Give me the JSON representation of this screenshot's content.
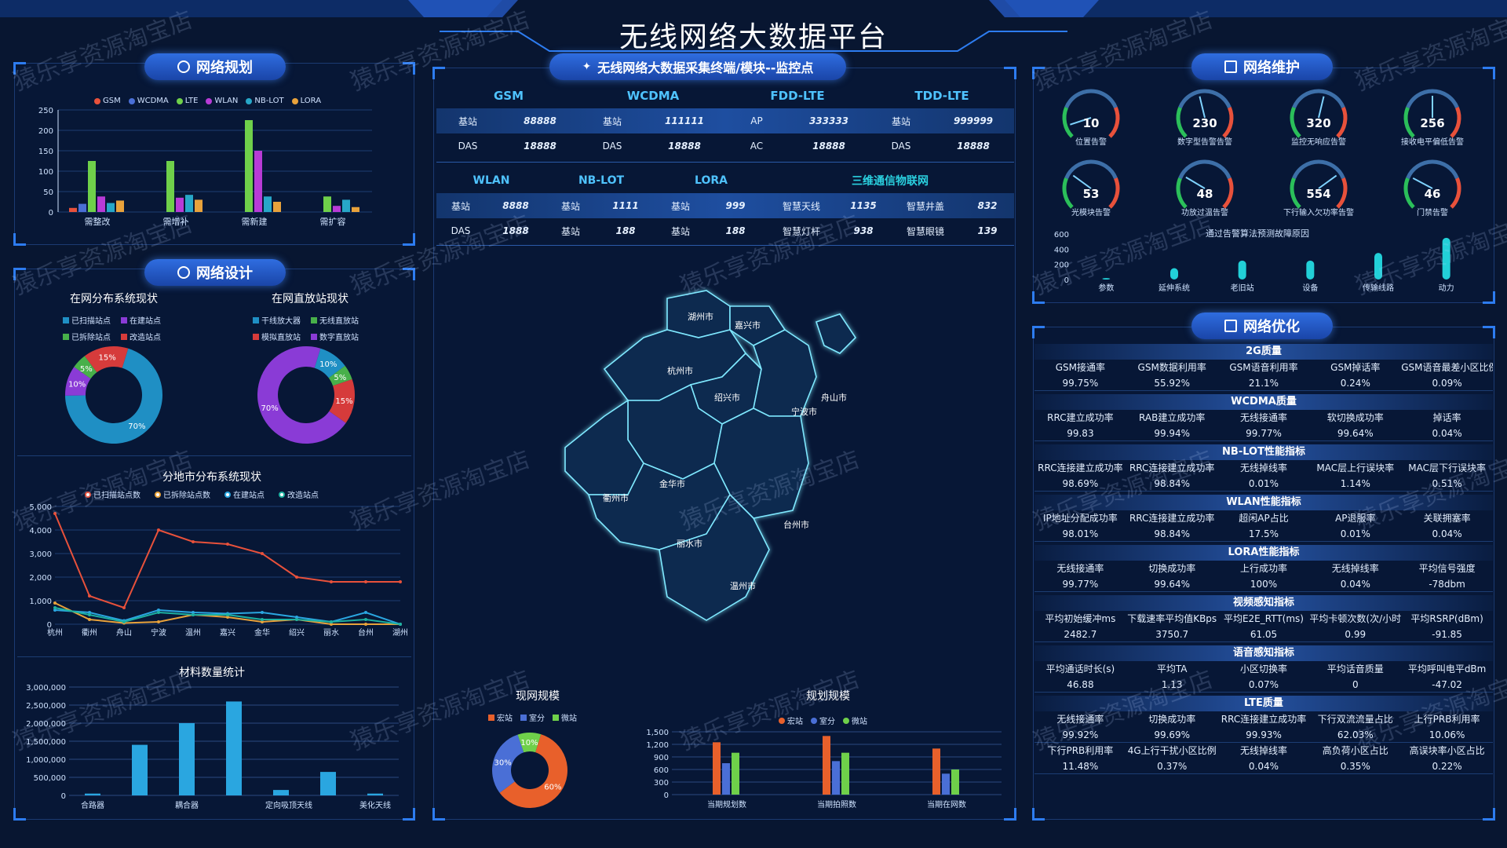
{
  "title": "无线网络大数据平台",
  "watermark": "猿乐享资源淘宝店",
  "colors": {
    "gsm": "#e8513b",
    "wcdma": "#4a6fd6",
    "lte": "#6fd04a",
    "wlan": "#b83bd6",
    "nblot": "#27a7c8",
    "lora": "#e8a23b"
  },
  "left": {
    "planning": {
      "title": "网络规划",
      "legend": [
        "GSM",
        "WCDMA",
        "LTE",
        "WLAN",
        "NB-LOT",
        "LORA"
      ],
      "yticks": [
        "250",
        "200",
        "150",
        "100",
        "50",
        "0"
      ],
      "chart_data": {
        "type": "bar",
        "categories": [
          "需整改",
          "需增补",
          "需新建",
          "需扩容"
        ],
        "ylim": [
          0,
          250
        ],
        "series": [
          {
            "name": "GSM",
            "values": [
              10,
              0,
              0,
              0
            ]
          },
          {
            "name": "WCDMA",
            "values": [
              20,
              0,
              0,
              0
            ]
          },
          {
            "name": "LTE",
            "values": [
              125,
              125,
              225,
              38
            ]
          },
          {
            "name": "WLAN",
            "values": [
              38,
              35,
              150,
              15
            ]
          },
          {
            "name": "NB-LOT",
            "values": [
              22,
              42,
              38,
              30
            ]
          },
          {
            "name": "LORA",
            "values": [
              28,
              30,
              25,
              12
            ]
          }
        ]
      }
    },
    "design": {
      "title": "网络设计",
      "donut1": {
        "title": "在网分布系统现状",
        "legend": [
          "已扫描站点",
          "在建站点",
          "已拆除站点",
          "改造站点"
        ],
        "chart_data": {
          "type": "pie",
          "labels": [
            "已扫描站点",
            "在建站点",
            "已拆除站点",
            "改造站点"
          ],
          "values": [
            70,
            10,
            5,
            15
          ],
          "colors": [
            "#1f8fc4",
            "#8a3bd6",
            "#48b04a",
            "#d63b3b"
          ]
        },
        "pct": [
          "70%",
          "10%",
          "5%",
          "15%"
        ]
      },
      "donut2": {
        "title": "在网直放站现状",
        "legend": [
          "干线放大器",
          "无线直放站",
          "模拟直放站",
          "数字直放站"
        ],
        "chart_data": {
          "type": "pie",
          "labels": [
            "干线放大器",
            "无线直放站",
            "模拟直放站",
            "数字直放站"
          ],
          "values": [
            10,
            5,
            15,
            70
          ],
          "colors": [
            "#1f8fc4",
            "#48b04a",
            "#d63b3b",
            "#8a3bd6"
          ]
        },
        "pct": [
          "10%",
          "5%",
          "15%",
          "70%"
        ]
      },
      "line": {
        "title": "分地市分布系统现状",
        "legend": [
          "已扫描站点数",
          "已拆除站点数",
          "在建站点",
          "改造站点"
        ],
        "yticks": [
          "5,000",
          "4,000",
          "3,000",
          "2,000",
          "1,000",
          "0"
        ],
        "chart_data": {
          "type": "line",
          "categories": [
            "杭州",
            "衢州",
            "舟山",
            "宁波",
            "温州",
            "嘉兴",
            "金华",
            "绍兴",
            "丽水",
            "台州",
            "湖州"
          ],
          "ylim": [
            0,
            5000
          ],
          "series": [
            {
              "name": "已扫描站点数",
              "values": [
                4700,
                1200,
                700,
                4000,
                3500,
                3400,
                3000,
                2000,
                1800,
                1800,
                1800
              ],
              "color": "#e8513b"
            },
            {
              "name": "已拆除站点数",
              "values": [
                900,
                200,
                50,
                100,
                400,
                300,
                100,
                200,
                0,
                0,
                0
              ],
              "color": "#e8a23b"
            },
            {
              "name": "在建站点",
              "values": [
                600,
                500,
                150,
                600,
                500,
                450,
                500,
                300,
                100,
                500,
                0
              ],
              "color": "#2aa6e0"
            },
            {
              "name": "改造站点",
              "values": [
                700,
                400,
                100,
                500,
                400,
                400,
                200,
                200,
                100,
                200,
                0
              ],
              "color": "#1db0a0"
            }
          ]
        }
      }
    },
    "material": {
      "title": "材料数量统计",
      "yticks": [
        "3,000,000",
        "2,500,000",
        "2,000,000",
        "1,500,000",
        "1,000,000",
        "500,000",
        "0"
      ],
      "xlabels": [
        "合路器",
        "耦合器",
        "定向吸顶天线",
        "美化天线"
      ],
      "chart_data": {
        "type": "bar",
        "categories": [
          "合路器",
          "",
          "耦合器",
          "",
          "定向吸顶天线",
          "",
          "美化天线"
        ],
        "values": [
          50000,
          1400000,
          2000000,
          2600000,
          150000,
          650000,
          50000
        ],
        "ylim": [
          0,
          3000000
        ]
      }
    }
  },
  "center": {
    "pill": "无线网络大数据采集终端/模块--监控点",
    "t1_headers": [
      "GSM",
      "WCDMA",
      "FDD-LTE",
      "TDD-LTE"
    ],
    "t1_rows": [
      [
        "基站",
        "88888",
        "基站",
        "111111",
        "AP",
        "333333",
        "基站",
        "999999"
      ],
      [
        "DAS",
        "18888",
        "DAS",
        "18888",
        "AC",
        "18888",
        "DAS",
        "18888"
      ]
    ],
    "t2_headers": [
      "WLAN",
      "NB-LOT",
      "LORA",
      "三维通信物联网"
    ],
    "t2_rows": [
      [
        "基站",
        "8888",
        "基站",
        "1111",
        "基站",
        "999",
        "智慧天线",
        "1135",
        "智慧井盖",
        "832"
      ],
      [
        "DAS",
        "1888",
        "基站",
        "188",
        "基站",
        "188",
        "智慧灯杆",
        "938",
        "智慧眼镜",
        "139"
      ]
    ],
    "map_cities": [
      "湖州市",
      "嘉兴市",
      "杭州市",
      "绍兴市",
      "舟山市",
      "宁波市",
      "金华市",
      "衢州市",
      "台州市",
      "丽水市",
      "温州市"
    ],
    "scale": {
      "title": "现网规模",
      "legend": [
        "宏站",
        "室分",
        "微站"
      ],
      "chart_data": {
        "type": "pie",
        "labels": [
          "宏站",
          "室分",
          "微站"
        ],
        "values": [
          60,
          30,
          10
        ],
        "colors": [
          "#e8602b",
          "#4a6fd6",
          "#6fd04a"
        ]
      },
      "pct": [
        "60%",
        "30%",
        "10%"
      ]
    },
    "plan": {
      "title": "规划规模",
      "legend": [
        "宏站",
        "室分",
        "微站"
      ],
      "yticks": [
        "1,500",
        "1,200",
        "900",
        "600",
        "300",
        "0"
      ],
      "chart_data": {
        "type": "bar",
        "categories": [
          "当期规划数",
          "当期拍照数",
          "当期在网数"
        ],
        "ylim": [
          0,
          1500
        ],
        "series": [
          {
            "name": "宏站",
            "values": [
              1250,
              1400,
              1100
            ]
          },
          {
            "name": "室分",
            "values": [
              750,
              800,
              500
            ]
          },
          {
            "name": "微站",
            "values": [
              1000,
              1000,
              600
            ]
          }
        ]
      }
    }
  },
  "right": {
    "maint": {
      "title": "网络维护",
      "gauges": [
        {
          "value": "10",
          "label": "位置告警",
          "ratio": 0.1
        },
        {
          "value": "230",
          "label": "数字型告警告警",
          "ratio": 0.45
        },
        {
          "value": "320",
          "label": "监控无响应告警",
          "ratio": 0.55
        },
        {
          "value": "256",
          "label": "接收电平偏低告警",
          "ratio": 0.5
        },
        {
          "value": "53",
          "label": "光模块告警",
          "ratio": 0.3
        },
        {
          "value": "48",
          "label": "功放过温告警",
          "ratio": 0.28
        },
        {
          "value": "554",
          "label": "下行输入欠功率告警",
          "ratio": 0.7
        },
        {
          "value": "46",
          "label": "门禁告警",
          "ratio": 0.27
        }
      ],
      "bar_title": "通过告警算法预测故障原因",
      "yticks": [
        "600",
        "400",
        "200",
        "0"
      ],
      "chart_data": {
        "type": "bar",
        "categories": [
          "参数",
          "延伸系统",
          "老旧站",
          "设备",
          "传输线路",
          "动力"
        ],
        "values": [
          20,
          150,
          250,
          250,
          350,
          550
        ],
        "ylim": [
          0,
          600
        ]
      }
    },
    "opt": {
      "title": "网络优化",
      "sections": [
        {
          "name": "2G质量",
          "heads": [
            "GSM接通率",
            "GSM数据利用率",
            "GSM语音利用率",
            "GSM掉话率",
            "GSM语音最差小区比例"
          ],
          "vals": [
            "99.75%",
            "55.92%",
            "21.1%",
            "0.24%",
            "0.09%"
          ]
        },
        {
          "name": "WCDMA质量",
          "heads": [
            "RRC建立成功率",
            "RAB建立成功率",
            "无线接通率",
            "软切换成功率",
            "掉话率"
          ],
          "vals": [
            "99.83",
            "99.94%",
            "99.77%",
            "99.64%",
            "0.04%"
          ]
        },
        {
          "name": "NB-LOT性能指标",
          "heads": [
            "RRC连接建立成功率",
            "RRC连接建立成功率",
            "无线掉线率",
            "MAC层上行误块率",
            "MAC层下行误块率"
          ],
          "vals": [
            "98.69%",
            "98.84%",
            "0.01%",
            "1.14%",
            "0.51%"
          ]
        },
        {
          "name": "WLAN性能指标",
          "heads": [
            "IP地址分配成功率",
            "RRC连接建立成功率",
            "超闲AP占比",
            "AP退服率",
            "关联拥塞率"
          ],
          "vals": [
            "98.01%",
            "98.84%",
            "17.5%",
            "0.01%",
            "0.04%"
          ]
        },
        {
          "name": "LORA性能指标",
          "heads": [
            "无线接通率",
            "切换成功率",
            "上行成功率",
            "无线掉线率",
            "平均信号强度"
          ],
          "vals": [
            "99.77%",
            "99.64%",
            "100%",
            "0.04%",
            "-78dbm"
          ]
        },
        {
          "name": "视频感知指标",
          "heads": [
            "平均初始缓冲ms",
            "下载速率平均值KBps",
            "平均E2E_RTT(ms)",
            "平均卡顿次数(次/小时)",
            "平均RSRP(dBm)"
          ],
          "vals": [
            "2482.7",
            "3750.7",
            "61.05",
            "0.99",
            "-91.85"
          ]
        },
        {
          "name": "语音感知指标",
          "heads": [
            "平均通话时长(s)",
            "平均TA",
            "小区切换率",
            "平均话音质量",
            "平均呼叫电平dBm"
          ],
          "vals": [
            "46.88",
            "1.13",
            "0.07%",
            "0",
            "-47.02"
          ]
        },
        {
          "name": "LTE质量",
          "heads": [
            "无线接通率",
            "切换成功率",
            "RRC连接建立成功率",
            "下行双流流量占比",
            "上行PRB利用率"
          ],
          "vals": [
            "99.92%",
            "99.69%",
            "99.93%",
            "62.03%",
            "10.06%"
          ],
          "heads2": [
            "下行PRB利用率",
            "4G上行干扰小区比例",
            "无线掉线率",
            "高负荷小区占比",
            "高误块率小区占比"
          ],
          "vals2": [
            "11.48%",
            "0.37%",
            "0.04%",
            "0.35%",
            "0.22%"
          ]
        }
      ]
    }
  }
}
